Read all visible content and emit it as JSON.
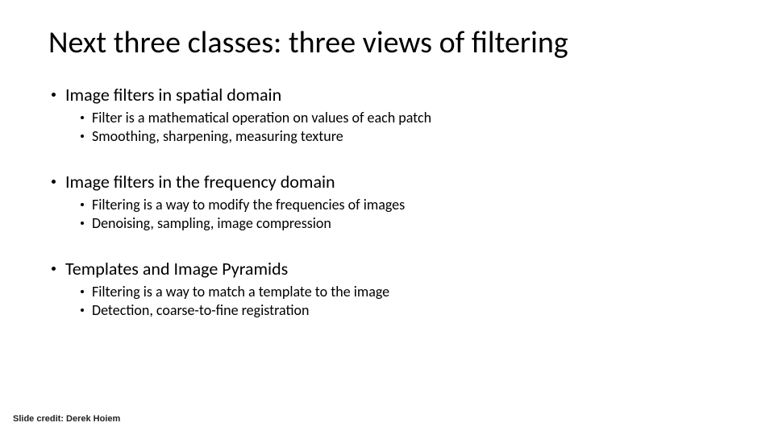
{
  "title": "Next three classes: three views of filtering",
  "sections": [
    {
      "heading": "Image filters in spatial domain",
      "items": [
        "Filter is a mathematical operation on values of each patch",
        "Smoothing, sharpening, measuring texture"
      ]
    },
    {
      "heading": "Image filters in the frequency domain",
      "items": [
        "Filtering is a way to modify the frequencies of images",
        "Denoising, sampling, image compression"
      ]
    },
    {
      "heading": "Templates and Image Pyramids",
      "items": [
        "Filtering is a way to match a template to the image",
        "Detection, coarse-to-fine registration"
      ]
    }
  ],
  "credit": "Slide credit: Derek Hoiem"
}
